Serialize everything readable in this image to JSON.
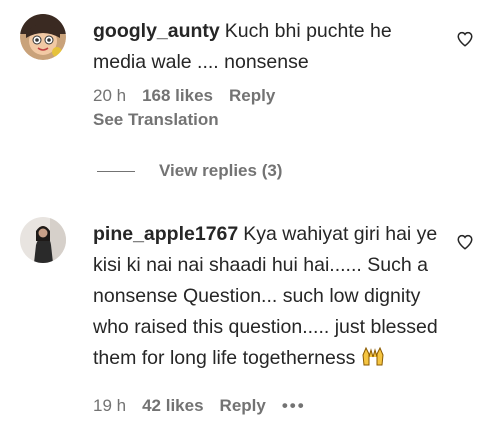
{
  "comments": [
    {
      "username": "googly_aunty",
      "text": "Kuch bhi puchte he media wale .... nonsense",
      "time": "20 h",
      "likes": "168 likes",
      "reply_label": "Reply",
      "see_translation": "See Translation",
      "avatar_icon": "cartoon-girl-avatar",
      "view_replies": "View replies (3)"
    },
    {
      "username": "pine_apple1767",
      "text": "Kya wahiyat giri hai ye kisi ki nai nai shaadi hui hai...... Such a nonsense Question... such low dignity who raised this question..... just blessed them for long life togetherness",
      "emoji": "raised-hands-emoji",
      "time": "19 h",
      "likes": "42 likes",
      "reply_label": "Reply",
      "more_label": "•••",
      "avatar_icon": "photo-avatar"
    }
  ],
  "colors": {
    "text": "#262626",
    "secondary": "#737373",
    "background": "#ffffff"
  }
}
